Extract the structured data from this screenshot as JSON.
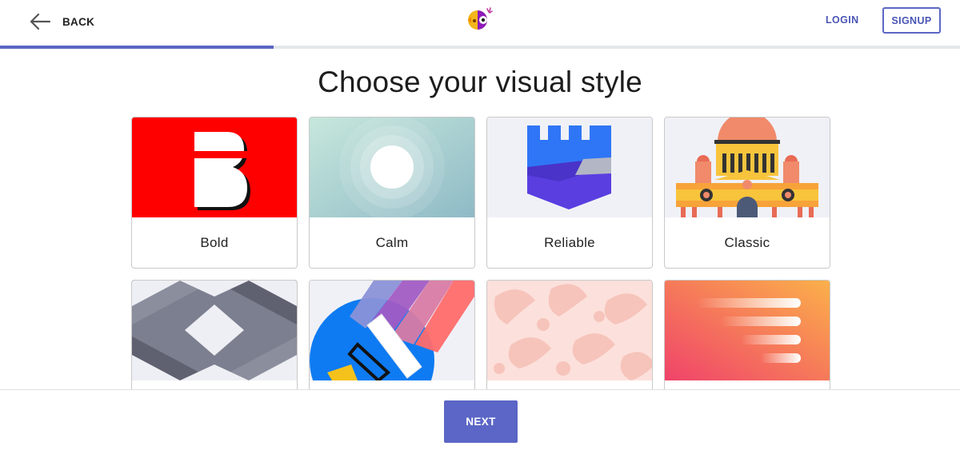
{
  "header": {
    "back_label": "BACK",
    "login_label": "LOGIN",
    "signup_label": "SIGNUP",
    "logo_icon": "parrot-logo-icon"
  },
  "progress": {
    "fraction": 0.285,
    "color": "#5b66c2"
  },
  "title": "Choose your visual style",
  "styles": [
    {
      "label": "Bold",
      "icon": "bold-b-icon"
    },
    {
      "label": "Calm",
      "icon": "calm-circles-icon"
    },
    {
      "label": "Reliable",
      "icon": "castle-shield-icon"
    },
    {
      "label": "Classic",
      "icon": "classic-building-icon"
    },
    {
      "label": "",
      "icon": "geometric-pattern-icon"
    },
    {
      "label": "",
      "icon": "paint-roller-icon"
    },
    {
      "label": "",
      "icon": "floral-pattern-icon"
    },
    {
      "label": "",
      "icon": "speed-lines-icon"
    }
  ],
  "footer": {
    "next_label": "NEXT"
  },
  "colors": {
    "accent": "#5b66c6",
    "link": "#4a55b5"
  }
}
